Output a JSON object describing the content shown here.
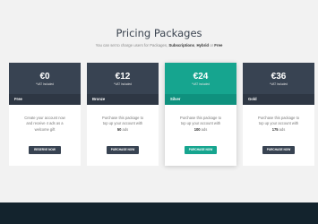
{
  "header": {
    "title": "Pricing Packages",
    "subtitle_prefix": "You can set to charge users for Packages, ",
    "subtitle_sub": "Subscriptions",
    "subtitle_sep": ", ",
    "subtitle_hybrid": "Hybrid",
    "subtitle_or": " or ",
    "subtitle_free": "Free"
  },
  "packages": [
    {
      "price": "€0",
      "vat": "*VAT Included",
      "name": "Free",
      "desc_line1": "Create your account now",
      "desc_line2": "and receive 4 ads as a",
      "desc_line3": "welcome gift",
      "button": "RESERVE NOW"
    },
    {
      "price": "€12",
      "vat": "*VAT Included",
      "name": "Bronze",
      "desc_line1": "Purchase this package to",
      "desc_line2": "top up your account with",
      "desc_amount": "50",
      "desc_unit": " ads",
      "button": "PURCHASE NOW"
    },
    {
      "price": "€24",
      "vat": "*VAT Included",
      "name": "Silver",
      "desc_line1": "Purchase this package to",
      "desc_line2": "top up your account with",
      "desc_amount": "100",
      "desc_unit": " ads",
      "button": "PURCHASE NOW"
    },
    {
      "price": "€36",
      "vat": "*VAT Included",
      "name": "Gold",
      "desc_line1": "Purchase this package to",
      "desc_line2": "top up your account with",
      "desc_amount": "175",
      "desc_unit": " ads",
      "button": "PURCHASE NOW"
    }
  ],
  "colors": {
    "card_header": "#384352",
    "featured": "#16a58f",
    "footer": "#13232d",
    "background": "#f2f2f2"
  }
}
